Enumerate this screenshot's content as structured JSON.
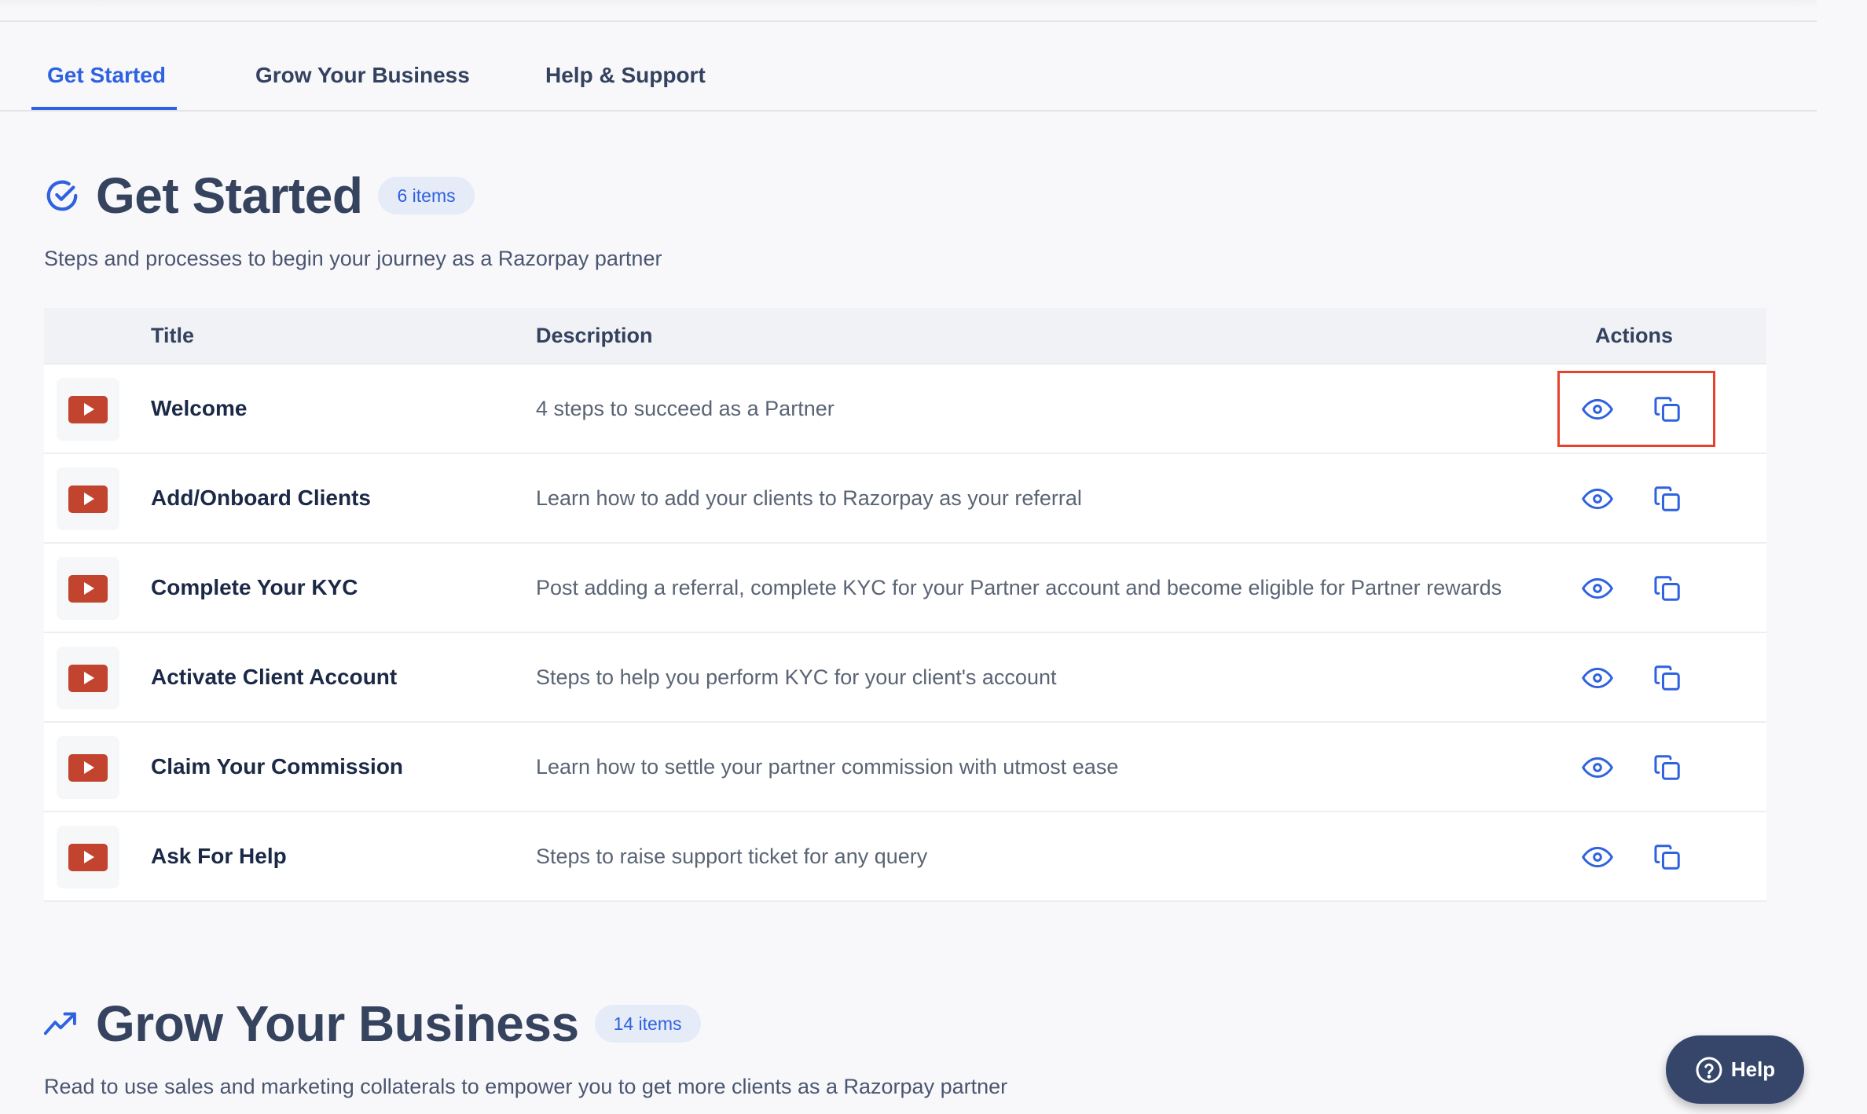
{
  "tabs": [
    {
      "label": "Get Started",
      "active": true
    },
    {
      "label": "Grow Your Business",
      "active": false
    },
    {
      "label": "Help & Support",
      "active": false
    }
  ],
  "colors": {
    "accent": "#2f62e0",
    "video_thumb": "#c2432e",
    "highlight_box": "#e8412c",
    "help_button": "#35466a"
  },
  "sections": {
    "get_started": {
      "icon": "check-circle-icon",
      "title": "Get Started",
      "badge": "6 items",
      "description": "Steps and processes to begin your journey as a Razorpay partner",
      "table": {
        "headers": {
          "title": "Title",
          "description": "Description",
          "actions": "Actions"
        },
        "rows": [
          {
            "thumb_icon": "video-play-icon",
            "title": "Welcome",
            "description": "4 steps to succeed as a Partner",
            "actions": [
              "view-icon",
              "copy-icon"
            ],
            "highlighted": true
          },
          {
            "thumb_icon": "video-play-icon",
            "title": "Add/Onboard Clients",
            "description": "Learn how to add your clients to Razorpay as your referral",
            "actions": [
              "view-icon",
              "copy-icon"
            ]
          },
          {
            "thumb_icon": "video-play-icon",
            "title": "Complete Your KYC",
            "description": "Post adding a referral, complete KYC for your Partner account and become eligible for Partner rewards",
            "actions": [
              "view-icon",
              "copy-icon"
            ]
          },
          {
            "thumb_icon": "video-play-icon",
            "title": "Activate Client Account",
            "description": "Steps to help you perform KYC for your client's account",
            "actions": [
              "view-icon",
              "copy-icon"
            ]
          },
          {
            "thumb_icon": "video-play-icon",
            "title": "Claim Your Commission",
            "description": "Learn how to settle your partner commission with utmost ease",
            "actions": [
              "view-icon",
              "copy-icon"
            ]
          },
          {
            "thumb_icon": "video-play-icon",
            "title": "Ask For Help",
            "description": "Steps to raise support ticket for any query",
            "actions": [
              "view-icon",
              "copy-icon"
            ]
          }
        ]
      }
    },
    "grow_business": {
      "icon": "trending-up-icon",
      "title": "Grow Your Business",
      "badge": "14 items",
      "description": "Read to use sales and marketing collaterals to empower you to get more clients as a Razorpay partner"
    }
  },
  "help_button": {
    "icon": "question-circle-icon",
    "label": "Help"
  }
}
